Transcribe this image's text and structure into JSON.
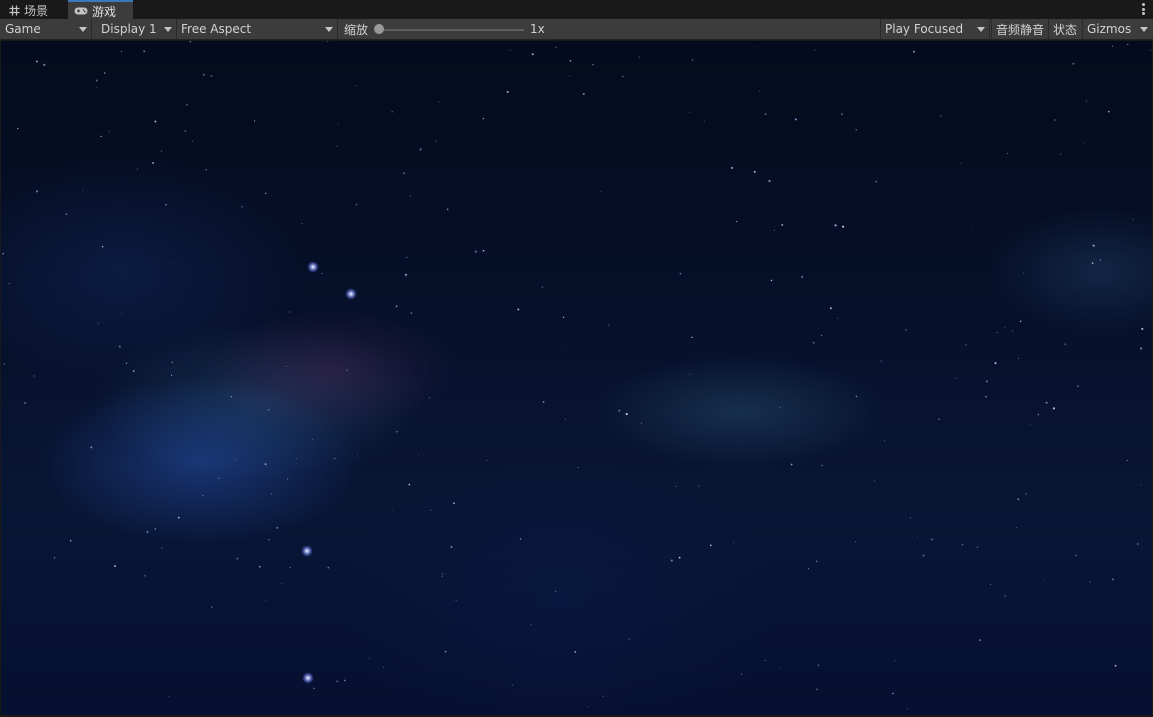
{
  "tabs": [
    {
      "label": "场景",
      "icon": "grid-icon",
      "active": false
    },
    {
      "label": "游戏",
      "icon": "gamepad-icon",
      "active": true
    }
  ],
  "toolbar": {
    "view_mode": "Game",
    "display": "Display 1",
    "aspect": "Free Aspect",
    "scale_label": "缩放",
    "scale_value": "1x",
    "scale_fraction": 0.0,
    "play_mode": "Play Focused",
    "mute_audio": "音频静音",
    "stats": "状态",
    "gizmos": "Gizmos"
  },
  "colors": {
    "tab_active_accent": "#3a79bb",
    "toolbar_bg": "#3c3c3c",
    "panel_bg": "#191919",
    "space_bg": "#06102a"
  }
}
